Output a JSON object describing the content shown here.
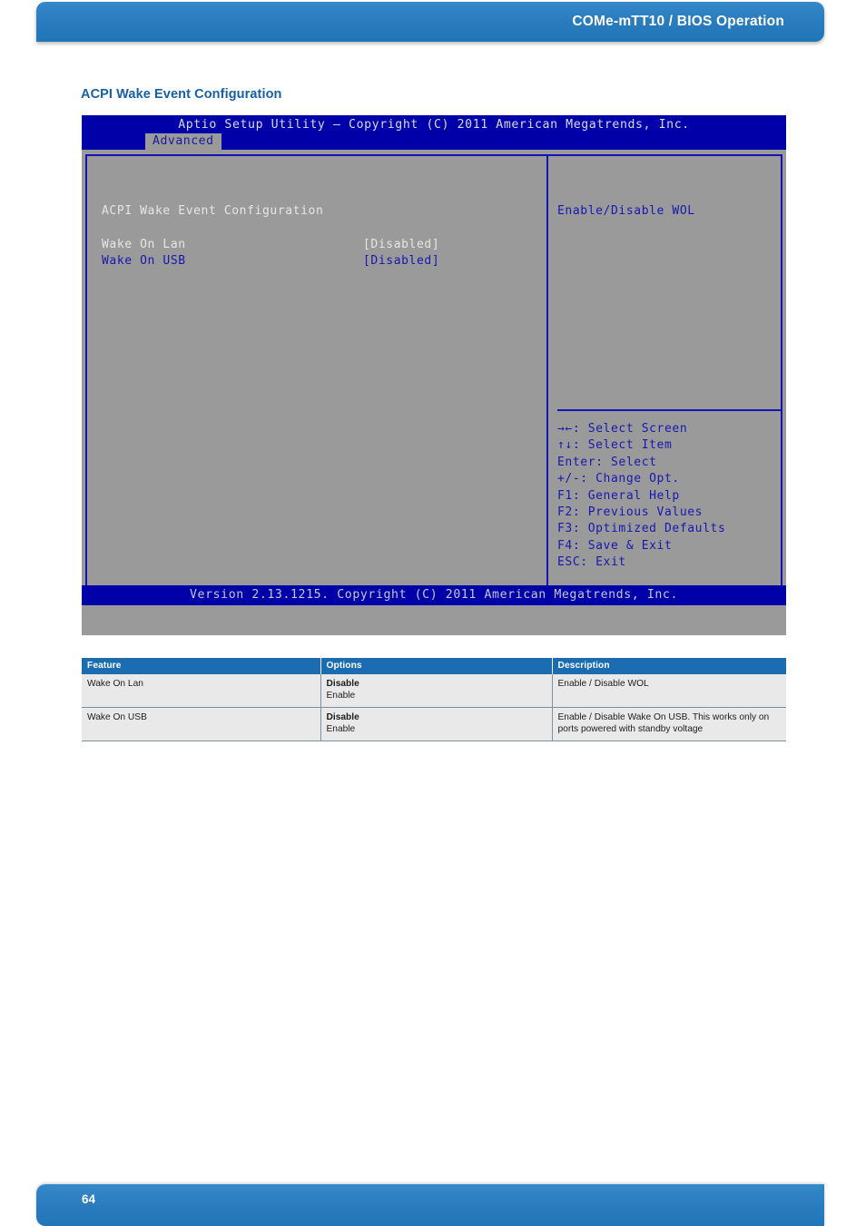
{
  "header": {
    "title": "COMe-mTT10 / BIOS Operation",
    "accent_color": "#2176b8"
  },
  "section": {
    "title": "ACPI Wake Event Configuration"
  },
  "bios": {
    "title": "Aptio Setup Utility – Copyright (C) 2011 American Megatrends, Inc.",
    "active_tab": "Advanced",
    "screen_heading": "ACPI Wake Event Configuration",
    "settings": [
      {
        "label": "Wake On Lan",
        "value": "[Disabled]",
        "state": "normal"
      },
      {
        "label": "Wake On USB",
        "value": "[Disabled]",
        "state": "selected"
      }
    ],
    "help_text": "Enable/Disable WOL",
    "keys": [
      "→←: Select Screen",
      "↑↓: Select Item",
      "Enter: Select",
      "+/-: Change Opt.",
      "F1: General Help",
      "F2: Previous Values",
      "F3: Optimized Defaults",
      "F4: Save & Exit",
      "ESC: Exit"
    ],
    "version_footer": "Version 2.13.1215. Copyright (C) 2011 American Megatrends, Inc.",
    "colors": {
      "chrome_blue": "#0000a8",
      "body_gray": "#9a9a9a",
      "text_blue": "#1818b0",
      "text_light": "#e6e6e6"
    }
  },
  "table": {
    "headers": [
      "Feature",
      "Options",
      "Description"
    ],
    "rows": [
      {
        "feature": "Wake On Lan",
        "option_default": "Disable",
        "option_alt": "Enable",
        "description": "Enable / Disable WOL"
      },
      {
        "feature": "Wake On USB",
        "option_default": "Disable",
        "option_alt": "Enable",
        "description": "Enable / Disable Wake On USB. This works only on ports powered with standby voltage"
      }
    ]
  },
  "footer": {
    "page_number": "64"
  }
}
